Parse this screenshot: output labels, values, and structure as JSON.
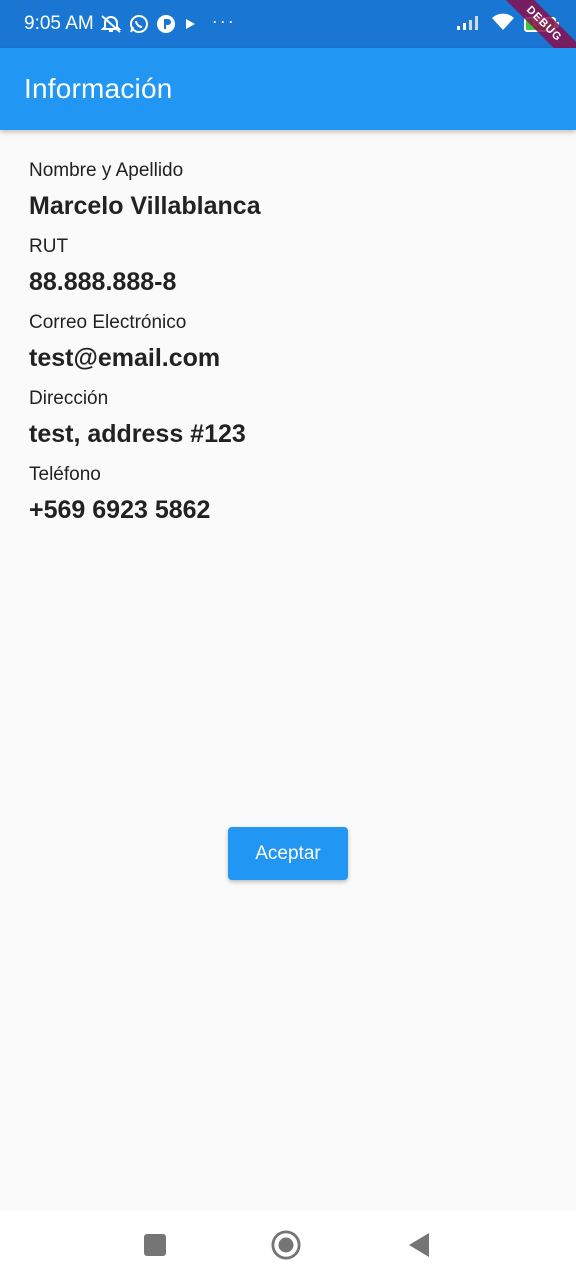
{
  "status_bar": {
    "time": "9:05 AM",
    "battery_level": "100",
    "debug_label": "DEBUG",
    "icons": [
      "muted-alarm-icon",
      "whatsapp-icon",
      "app-circle-icon",
      "play-icon",
      "more-dots-icon",
      "signal-icon",
      "wifi-icon",
      "battery-icon"
    ]
  },
  "app_bar": {
    "title": "Información"
  },
  "fields": [
    {
      "label": "Nombre y Apellido",
      "value": "Marcelo Villablanca"
    },
    {
      "label": "RUT",
      "value": "88.888.888-8"
    },
    {
      "label": "Correo Electrónico",
      "value": "test@email.com"
    },
    {
      "label": "Dirección",
      "value": "test, address #123"
    },
    {
      "label": "Teléfono",
      "value": "+569 6923 5862"
    }
  ],
  "actions": {
    "accept_label": "Aceptar"
  },
  "colors": {
    "primary": "#2196f3",
    "status_bar": "#1976d2",
    "background": "#fafafa"
  },
  "nav_bar": {
    "icons": [
      "recents-square-icon",
      "home-circle-icon",
      "back-triangle-icon"
    ]
  }
}
